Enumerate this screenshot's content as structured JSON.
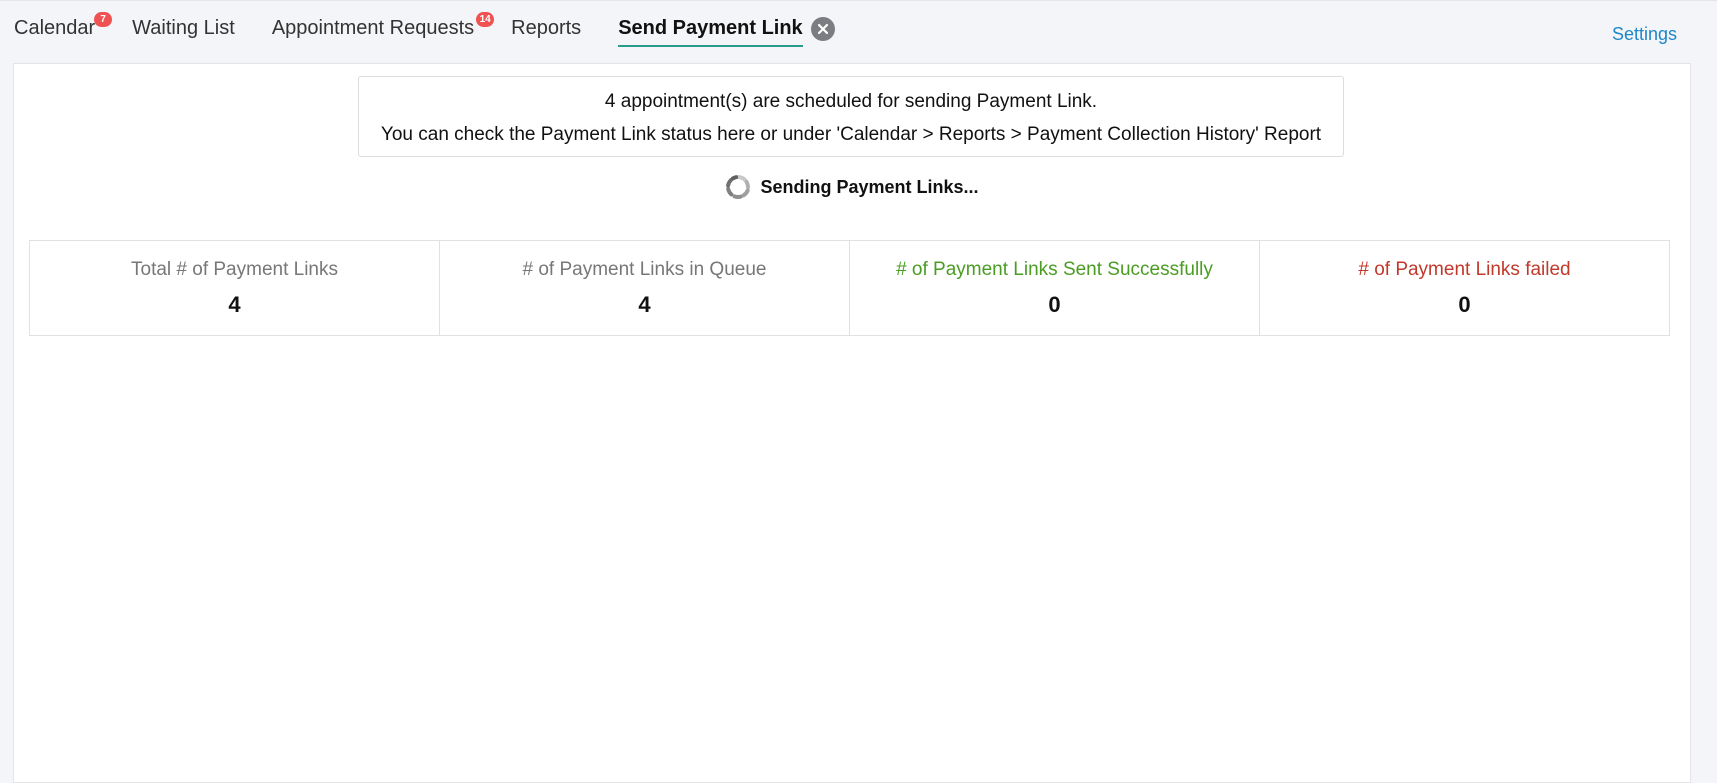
{
  "tabs": [
    {
      "label": "Calendar",
      "badge": "7"
    },
    {
      "label": "Waiting List"
    },
    {
      "label": "Appointment Requests",
      "badge": "14"
    },
    {
      "label": "Reports"
    },
    {
      "label": "Send Payment Link",
      "active": true
    }
  ],
  "settings_label": "Settings",
  "notice": {
    "line1": "4 appointment(s) are scheduled for sending Payment Link.",
    "line2": "You can check the Payment Link status here or under 'Calendar > Reports > Payment Collection History' Report"
  },
  "sending_label": "Sending Payment Links...",
  "stats": [
    {
      "label": "Total # of Payment Links",
      "value": "4",
      "color": "#777777"
    },
    {
      "label": "# of Payment Links in Queue",
      "value": "4",
      "color": "#777777"
    },
    {
      "label": "# of Payment Links Sent Successfully",
      "value": "0",
      "color": "#4a9d22"
    },
    {
      "label": "# of Payment Links failed",
      "value": "0",
      "color": "#c0392b"
    }
  ],
  "colors": {
    "accent": "#2a9c8c",
    "link": "#1e87c8",
    "badge": "#f05252"
  }
}
